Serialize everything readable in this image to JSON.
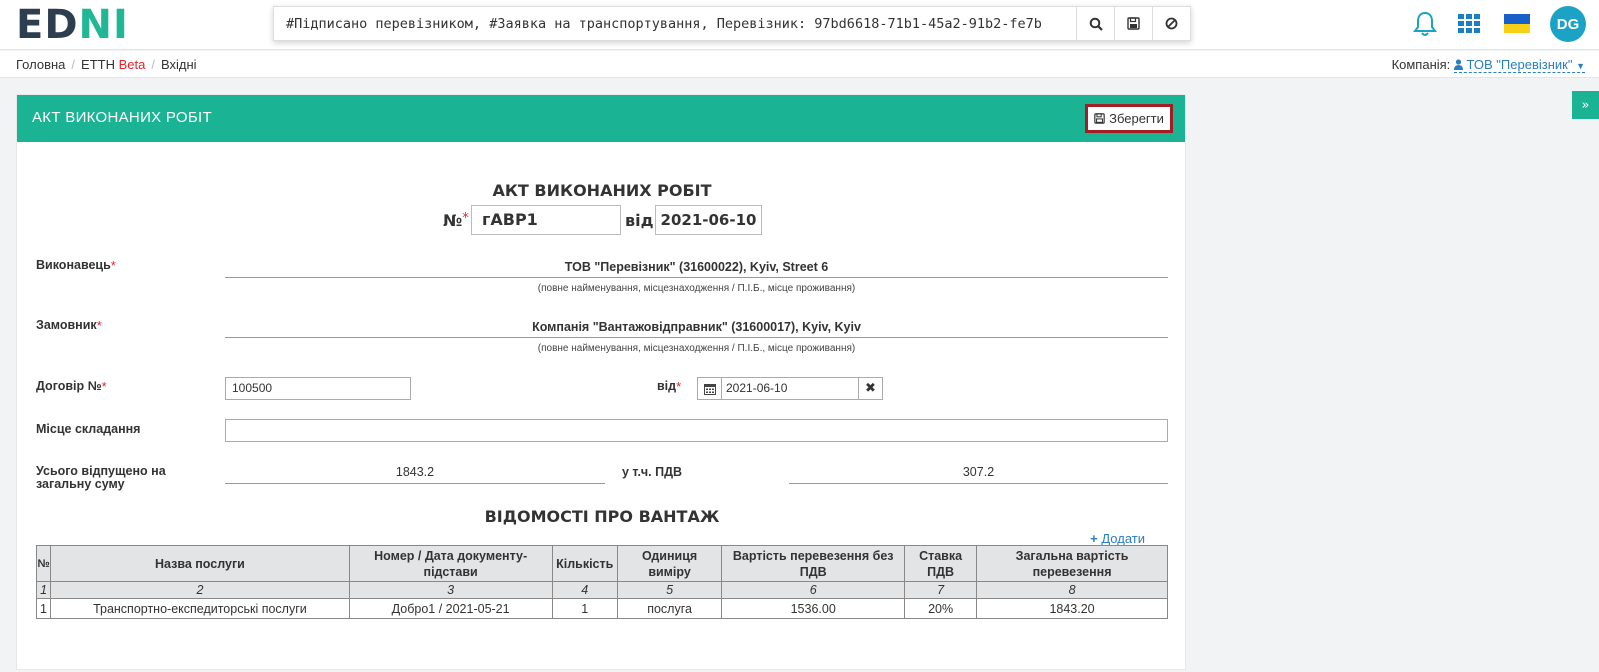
{
  "header": {
    "logo_part1": "ED",
    "logo_part2": "IN",
    "search_value": "#Підписано перевізником, #Заявка на транспортування, Перевізник: 97bd6618-71b1-45a2-91b2-fe7b",
    "user_initials": "DG",
    "colors": {
      "brand": "#1ab394",
      "avatar": "#1ba3c6"
    }
  },
  "breadcrumb": {
    "home": "Головна",
    "section": "ЕТТН",
    "section_badge": "Beta",
    "current": "Вхідні"
  },
  "company": {
    "label": "Компанія:",
    "name": "ТОВ \"Перевізник\""
  },
  "panel": {
    "title": "АКТ ВИКОНАНИХ РОБІТ",
    "save_label": "Зберегти"
  },
  "doc": {
    "title": "АКТ ВИКОНАНИХ РОБІТ",
    "number_label": "№",
    "number": "гАВР1",
    "from_label": "від",
    "date": "2021-06-10",
    "executor_label": "Виконавець",
    "executor": "ТОВ \"Перевізник\" (31600022), Kyiv, Street 6",
    "executor_hint": "(повне найменування, місцезнаходження / П.І.Б., місце проживання)",
    "customer_label": "Замовник",
    "customer": "Компанія \"Вантажовідправник\" (31600017), Kyiv, Kyiv",
    "customer_hint": "(повне найменування, місцезнаходження / П.І.Б., місце проживання)",
    "contract_label": "Договір №",
    "contract_number": "100500",
    "contract_date_label": "від",
    "contract_date": "2021-06-10",
    "place_label": "Місце складання",
    "place_value": "",
    "total_label": "Усього відпущено на загальну суму",
    "total_value": "1843.2",
    "vat_label": "у т.ч. ПДВ",
    "vat_value": "307.2"
  },
  "goods": {
    "title": "ВІДОМОСТІ ПРО ВАНТАЖ",
    "add_label": "Додати",
    "headers": [
      "№",
      "Назва послуги",
      "Номер / Дата документу-підстави",
      "Кількість",
      "Одиниця виміру",
      "Вартість перевезення без ПДВ",
      "Ставка ПДВ",
      "Загальна вартість перевезення"
    ],
    "numbers": [
      "1",
      "2",
      "3",
      "4",
      "5",
      "6",
      "7",
      "8"
    ],
    "rows": [
      [
        "1",
        "Транспортно-експедиторські послуги",
        "Добро1 / 2021-05-21",
        "1",
        "послуга",
        "1536.00",
        "20%",
        "1843.20"
      ]
    ]
  }
}
